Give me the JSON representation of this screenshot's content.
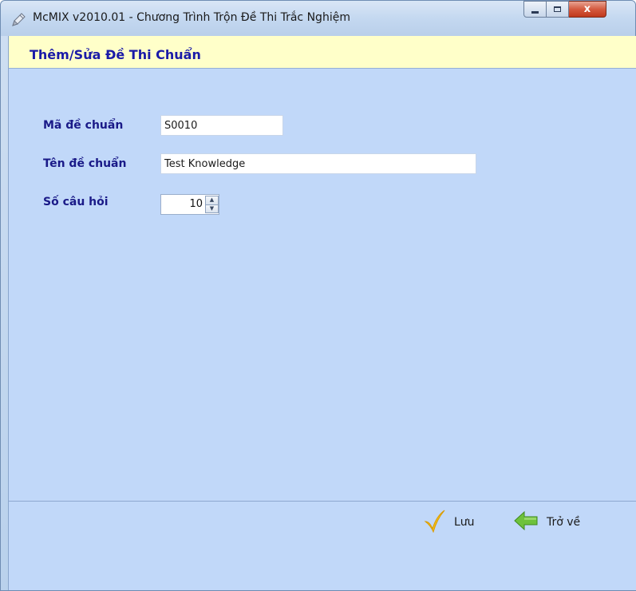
{
  "window": {
    "title": "McMIX v2010.01 - Chương Trình Trộn Đề Thi Trắc Nghiệm",
    "controls": {
      "minimize_icon": "minimize-icon",
      "maximize_icon": "maximize-icon",
      "close_label": "x"
    }
  },
  "header": {
    "title": "Thêm/Sửa Đề Thi Chuẩn"
  },
  "form": {
    "code": {
      "label": "Mã đề chuẩn",
      "value": "S0010"
    },
    "name": {
      "label": "Tên đề chuẩn",
      "value": "Test Knowledge"
    },
    "question_count": {
      "label": "Số câu hỏi",
      "value": "10"
    }
  },
  "actions": {
    "save": {
      "label": "Lưu",
      "icon": "checkmark-icon"
    },
    "back": {
      "label": "Trở về",
      "icon": "back-arrow-icon"
    }
  },
  "colors": {
    "content_bg": "#c1d8f9",
    "header_bg": "#ffffc9",
    "label_color": "#1a1a88",
    "header_title_color": "#1a1aa8"
  }
}
